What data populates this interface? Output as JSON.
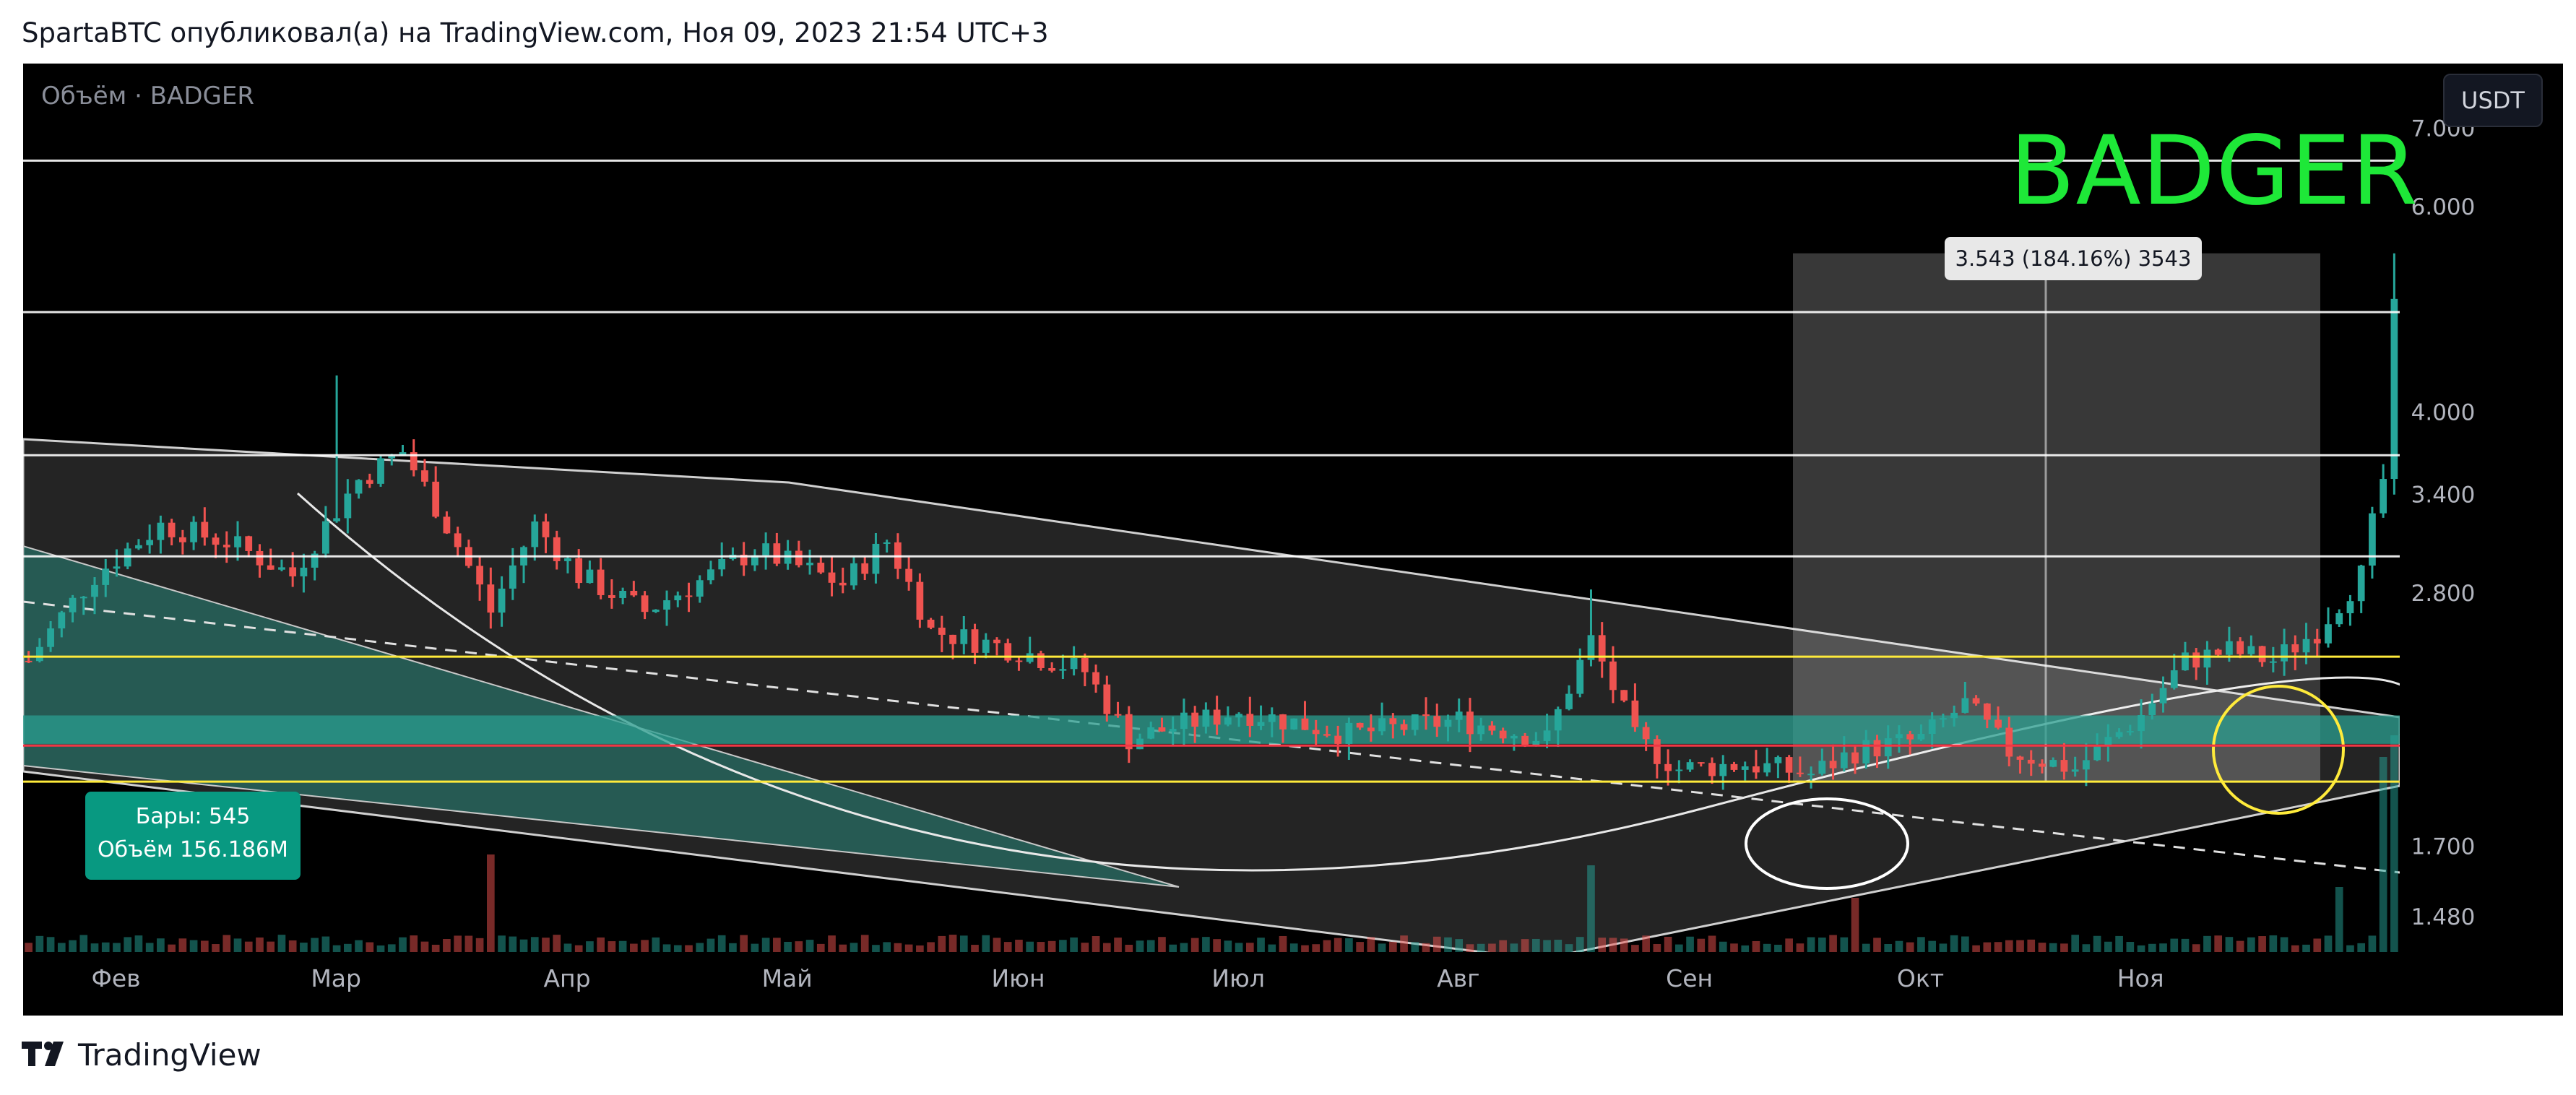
{
  "header": {
    "publish_line": "SpartaBTC опубликовал(а) на TradingView.com, Ноя 09, 2023 21:54 UTC+3"
  },
  "chart": {
    "volume_legend": "Объём · BADGER",
    "currency": "USDT",
    "symbol": "BADGER",
    "measure_label": "3.543 (184.16%) 3543",
    "stats": {
      "bars": "Бары: 545",
      "volume": "Объём 156.186M"
    }
  },
  "footer": {
    "brand": "TradingView"
  },
  "colors": {
    "background": "#000000",
    "up_candle": "#26a69a",
    "down_candle": "#ef5350",
    "symbol_text": "#1ee838",
    "level_yellow": "#ffeb3b",
    "level_red": "#f23645",
    "zone_teal": "#2a9d8f"
  },
  "chart_data": {
    "type": "candlestick",
    "y_scale": "log",
    "ylim": [
      1.42,
      7.3
    ],
    "x_tick_labels": [
      "Фев",
      "Мар",
      "Апр",
      "Май",
      "Июн",
      "Июл",
      "Авг",
      "Сен",
      "Окт",
      "Ноя"
    ],
    "y_tick_labels": [
      "7.000",
      "6.000",
      "4.000",
      "3.400",
      "2.800",
      "1.700",
      "1.480"
    ],
    "price_levels": [
      {
        "value": "6.566",
        "color": "#ffffff"
      },
      {
        "value": "4.871",
        "color": "#ffffff"
      },
      {
        "value": "3.674",
        "color": "#ffffff"
      },
      {
        "value": "3.010",
        "color": "#ffffff"
      },
      {
        "value": "2.470",
        "color": "#ffeb3b"
      },
      {
        "value": "2.073",
        "color": "#f23645"
      },
      {
        "value": "1.931",
        "color": "#ffeb3b"
      }
    ],
    "teal_zone": [
      2.08,
      2.2
    ],
    "measure": {
      "from": 1.93,
      "to": 5.47,
      "change": "3.543 (184.16%) 3543"
    },
    "price_path": [
      [
        0,
        2.45
      ],
      [
        6,
        2.9
      ],
      [
        12,
        3.2
      ],
      [
        18,
        3.1
      ],
      [
        24,
        2.9
      ],
      [
        30,
        3.5
      ],
      [
        34,
        3.7
      ],
      [
        38,
        3.2
      ],
      [
        42,
        2.7
      ],
      [
        46,
        3.2
      ],
      [
        50,
        2.9
      ],
      [
        56,
        2.7
      ],
      [
        62,
        2.9
      ],
      [
        66,
        3.05
      ],
      [
        70,
        2.95
      ],
      [
        74,
        2.85
      ],
      [
        78,
        3.1
      ],
      [
        82,
        2.6
      ],
      [
        90,
        2.5
      ],
      [
        96,
        2.4
      ],
      [
        100,
        2.1
      ],
      [
        104,
        2.15
      ],
      [
        110,
        2.22
      ],
      [
        120,
        2.12
      ],
      [
        130,
        2.18
      ],
      [
        138,
        2.1
      ],
      [
        142,
        2.55
      ],
      [
        146,
        2.1
      ],
      [
        150,
        1.98
      ],
      [
        156,
        2.0
      ],
      [
        162,
        1.96
      ],
      [
        166,
        2.05
      ],
      [
        172,
        2.1
      ],
      [
        176,
        2.25
      ],
      [
        180,
        2.05
      ],
      [
        186,
        1.98
      ],
      [
        192,
        2.2
      ],
      [
        196,
        2.45
      ],
      [
        200,
        2.5
      ],
      [
        204,
        2.45
      ],
      [
        208,
        2.6
      ],
      [
        212,
        2.9
      ],
      [
        214,
        3.5
      ],
      [
        215,
        5.0
      ]
    ],
    "volume_spikes": [
      [
        42,
        0.45
      ],
      [
        142,
        0.4
      ],
      [
        166,
        0.25
      ],
      [
        210,
        0.3
      ],
      [
        214,
        0.9
      ],
      [
        215,
        1.0
      ]
    ]
  }
}
